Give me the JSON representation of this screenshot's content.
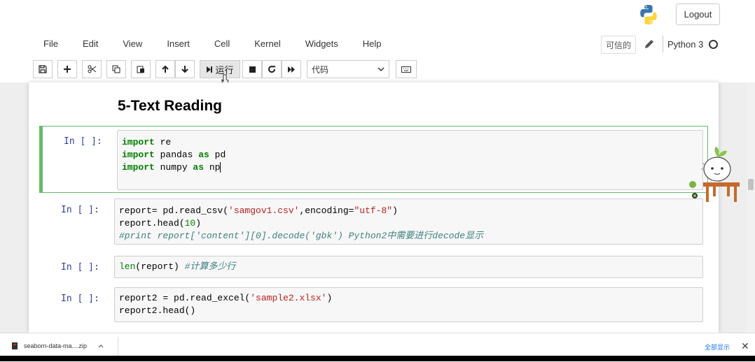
{
  "header": {
    "logout_label": "Logout",
    "menu": [
      "File",
      "Edit",
      "View",
      "Insert",
      "Cell",
      "Kernel",
      "Widgets",
      "Help"
    ],
    "trusted_label": "可信的",
    "kernel_name": "Python 3"
  },
  "toolbar": {
    "run_label": "运行",
    "cell_type": "代码"
  },
  "notebook": {
    "title": "5-Text Reading",
    "cells": [
      {
        "prompt": "In [ ]:",
        "lines": [
          "import re",
          "import pandas as pd",
          "import numpy as np"
        ]
      },
      {
        "prompt": "In [ ]:",
        "lines": [
          "report= pd.read_csv('samgov1.csv',encoding=\"utf-8\")",
          "report.head(10)",
          "#print report['content'][0].decode('gbk') Python2中需要进行decode显示"
        ]
      },
      {
        "prompt": "In [ ]:",
        "lines": [
          "len(report) #计算多少行"
        ]
      },
      {
        "prompt": "In [ ]:",
        "lines": [
          "report2 = pd.read_excel('sample2.xlsx')",
          "report2.head()"
        ]
      }
    ]
  },
  "downloads": {
    "file_name": "seaborn-data-ma....zip",
    "show_all": "全部显示"
  },
  "colors": {
    "selected_border": "#66bb6a",
    "prompt": "#303f9f",
    "keyword": "#008000",
    "string": "#ba2121",
    "comment": "#408080"
  }
}
